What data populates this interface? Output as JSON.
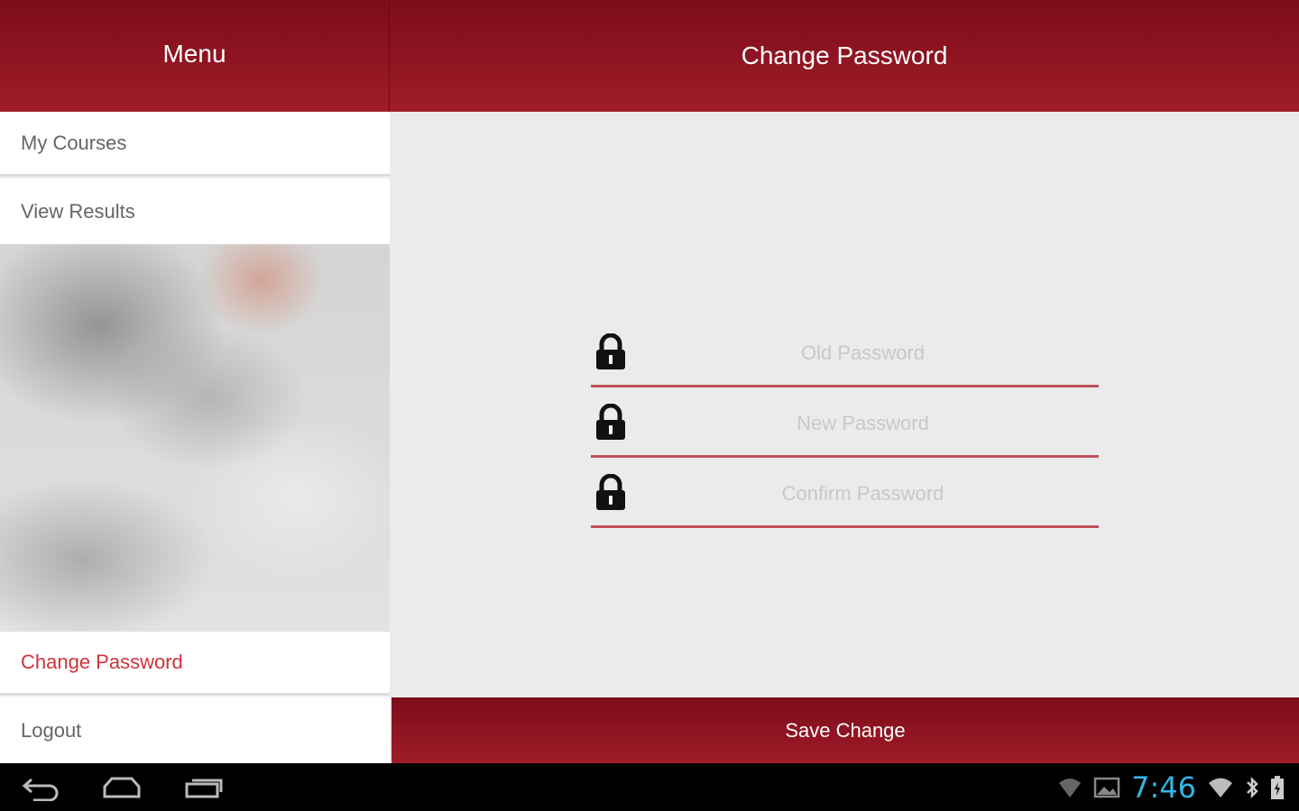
{
  "sidebar": {
    "title": "Menu",
    "items": [
      {
        "label": "My Courses"
      },
      {
        "label": "View Results"
      },
      {
        "label": "Change Password",
        "active": true
      },
      {
        "label": "Logout"
      }
    ]
  },
  "main": {
    "title": "Change Password",
    "fields": {
      "old_password": {
        "placeholder": "Old Password",
        "value": ""
      },
      "new_password": {
        "placeholder": "New Password",
        "value": ""
      },
      "confirm_password": {
        "placeholder": "Confirm Password",
        "value": ""
      }
    },
    "save_label": "Save Change"
  },
  "system_bar": {
    "time": "7:46",
    "icons": [
      "back-icon",
      "home-icon",
      "recent-apps-icon",
      "wifi-icon",
      "image-notification-icon",
      "wifi-signal-icon",
      "bluetooth-icon",
      "battery-icon"
    ]
  },
  "colors": {
    "brand_red": "#8e1420",
    "active_text": "#d0323c",
    "field_underline": "#c0505a",
    "clock": "#33b5e5"
  }
}
